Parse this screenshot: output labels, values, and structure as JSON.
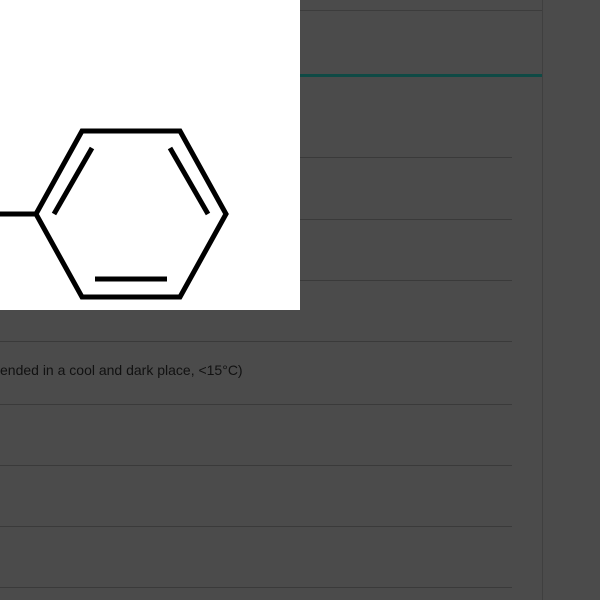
{
  "product": {
    "storage_text": "ended in a cool and dark place, <15°C)"
  }
}
